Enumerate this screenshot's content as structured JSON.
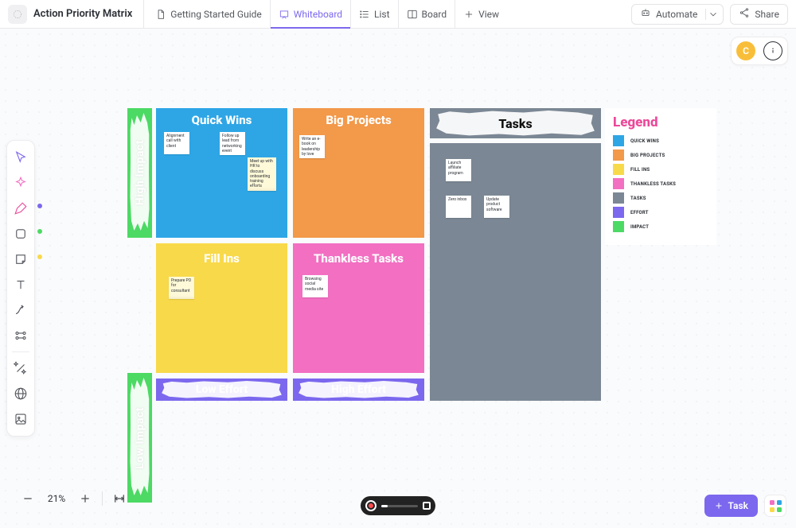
{
  "header": {
    "title": "Action Priority Matrix",
    "tabs": [
      {
        "label": "Getting Started Guide",
        "icon": "doc"
      },
      {
        "label": "Whiteboard",
        "icon": "whiteboard"
      },
      {
        "label": "List",
        "icon": "list"
      },
      {
        "label": "Board",
        "icon": "board"
      },
      {
        "label": "View",
        "icon": "plus"
      }
    ],
    "automate": "Automate",
    "share": "Share"
  },
  "avatar_initial": "C",
  "zoom": {
    "label": "21%"
  },
  "task_button": "Task",
  "board": {
    "axis": {
      "high_impact": "High Impact",
      "low_impact": "Low Impact",
      "low_effort": "Low Effort",
      "high_effort": "High Effort"
    },
    "quadrants": {
      "quick_wins": "Quick Wins",
      "big_projects": "Big Projects",
      "fill_ins": "Fill Ins",
      "thankless": "Thankless Tasks"
    },
    "tasks_header": "Tasks",
    "legend_title": "Legend",
    "legend": [
      {
        "label": "QUICK WINS",
        "color": "#2ea6e6"
      },
      {
        "label": "BIG PROJECTS",
        "color": "#f2994a"
      },
      {
        "label": "FILL INS",
        "color": "#f8d94a"
      },
      {
        "label": "THANKLESS TASKS",
        "color": "#f26fc2"
      },
      {
        "label": "TASKS",
        "color": "#7b8794"
      },
      {
        "label": "EFFORT",
        "color": "#7b68ee"
      },
      {
        "label": "IMPACT",
        "color": "#4cd964"
      }
    ],
    "notes": {
      "qw1": "Alignment call with client",
      "qw2": "Follow up lead from networking event",
      "qw3": "Meet up with HR to discuss onboarding training efforts",
      "bp1": "Write an e-book on leadership by love",
      "fi1": "Prepare PO for consultant",
      "tt1": "Browsing social media site",
      "tk1": "Launch affiliate program",
      "tk2": "Zero inbox",
      "tk3": "Update product software"
    }
  }
}
